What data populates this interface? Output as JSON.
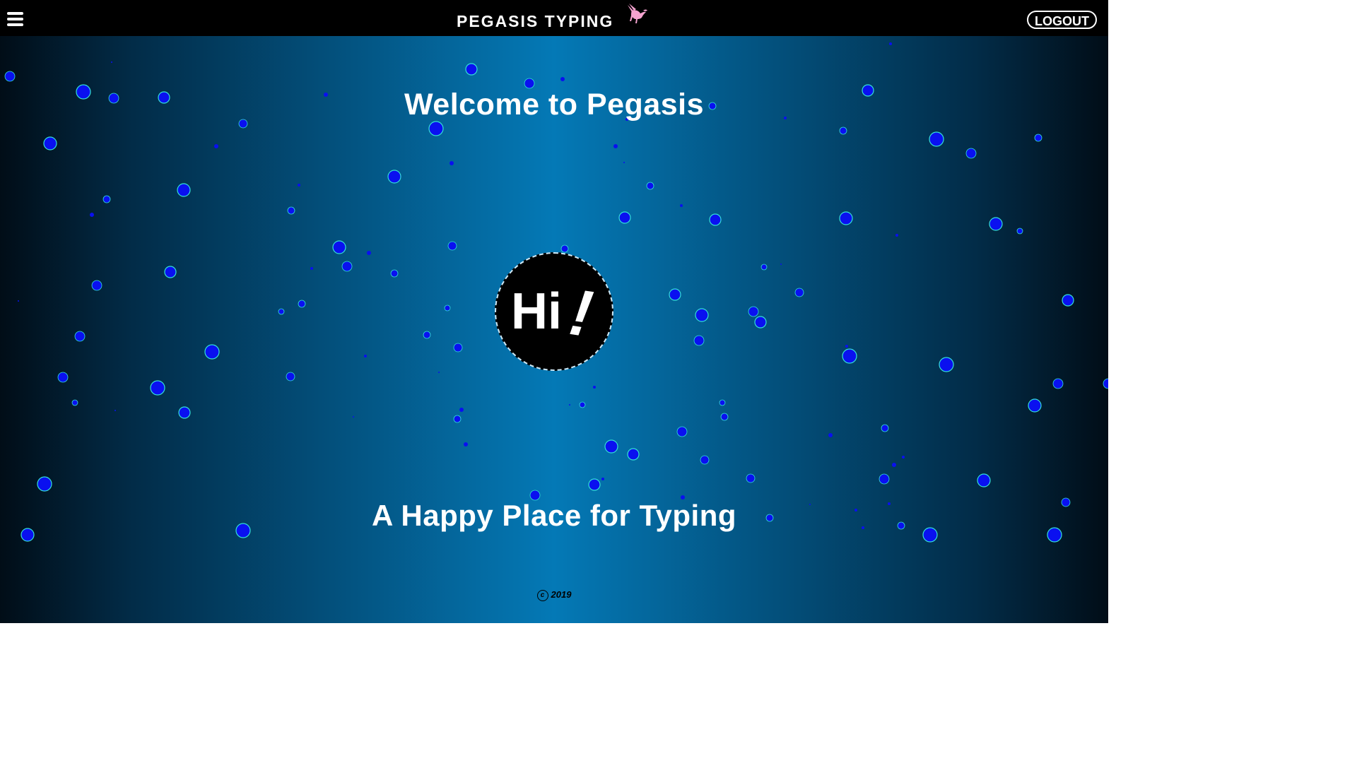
{
  "header": {
    "title": "PEGASIS TYPING",
    "logout_label": "LOGOUT",
    "menu_icon": "hamburger-menu-icon",
    "brand_icon": "pegasus-icon",
    "brand_icon_color": "#f5a3d0"
  },
  "main": {
    "welcome": "Welcome to Pegasis",
    "badge_text": "Hi",
    "badge_mark": "!",
    "tagline": "A Happy Place for Typing"
  },
  "footer": {
    "copyright_symbol": "c",
    "year": "2019"
  },
  "colors": {
    "bubble_fill": "#0a10f0",
    "bubble_stroke": "#33e0d8",
    "bar": "#000000",
    "background_center": "#0479b6",
    "background_edge": "#010d17"
  }
}
